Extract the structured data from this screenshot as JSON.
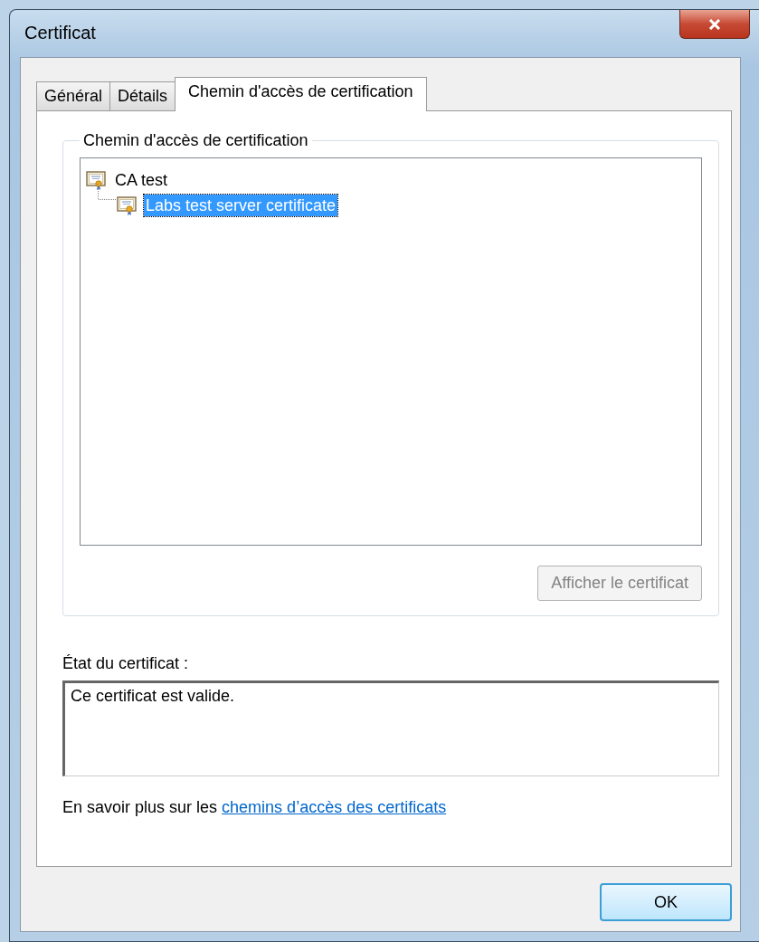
{
  "window": {
    "title": "Certificat"
  },
  "tabs": [
    {
      "label": "Général",
      "selected": false
    },
    {
      "label": "Détails",
      "selected": false
    },
    {
      "label": "Chemin d'accès de certification",
      "selected": true
    }
  ],
  "path_group": {
    "label": "Chemin d'accès de certification",
    "tree": [
      {
        "label": "CA test",
        "selected": false,
        "children": [
          {
            "label": "Labs test server certificate",
            "selected": true
          }
        ]
      }
    ],
    "view_button": {
      "label": "Afficher le certificat",
      "disabled": true
    }
  },
  "status": {
    "label": "État du certificat :",
    "value": "Ce certificat est valide."
  },
  "info": {
    "text": "En savoir plus sur les",
    "link": "chemins d’accès des certificats"
  },
  "buttons": [
    {
      "label": "OK",
      "default": true
    }
  ]
}
